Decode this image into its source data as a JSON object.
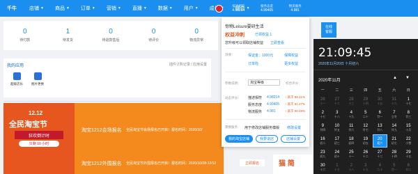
{
  "nav": {
    "logo": "千牛",
    "items": [
      "店铺",
      "商品",
      "订单",
      "营销",
      "直播",
      "数据",
      "用户",
      "成长",
      "综合"
    ]
  },
  "header_stats": [
    {
      "label": "描述相符",
      "value": "4.98214"
    },
    {
      "label": "服务态度",
      "value": "4.99405"
    },
    {
      "label": "物流服务",
      "value": "4.981"
    }
  ],
  "stats": [
    {
      "value": "0",
      "label": "待付款"
    },
    {
      "value": "1",
      "label": "待发货"
    },
    {
      "value": "0",
      "label": "待退款售后"
    },
    {
      "value": "0",
      "label": "待评价"
    },
    {
      "value": "0",
      "label": "物流异常"
    }
  ],
  "apps": {
    "title": "我的应用",
    "right": "插件订购记录 | 应用设置",
    "items": [
      {
        "label": "超级店长"
      },
      {
        "label": "图片更换"
      }
    ]
  },
  "banner": {
    "date": "12.12",
    "title": "全民淘宝节",
    "strip": "狂欢倒计时",
    "pill": "只剩 10 小时",
    "rows": [
      {
        "name": "淘宝1212会场报名",
        "desc": "全民淘宝节会场报名已开启！报名时间：2020/10/"
      },
      {
        "name": "淘宝1212外围报名",
        "desc": "全民淘宝节外围报名已开启！报名时间：2020/10/28-12/12"
      }
    ],
    "button": "立即报名"
  },
  "popup": {
    "shop_name": "惊物Leisure要研生活",
    "status": "权益冲刺",
    "status_link": "已领权益 1",
    "note": "您升级可以领取店铺权益",
    "note_link": "立即查看",
    "deposit_label": "消保：",
    "deposit_link": "保证金：1000元",
    "deposit_link2": "保障权益",
    "order_link": "订单险",
    "more_link": "更多权益",
    "level_label": "参数说明：",
    "level_value": "淘宝等级",
    "dsr_label": "综合评分：",
    "dsr_title": "动态评分：",
    "rows": [
      {
        "label": "描述相符",
        "value": "4.98214",
        "trend": "↑ 高于 89.21%"
      },
      {
        "label": "服务态度",
        "value": "4.99405",
        "trend": "↑ 高于 91.47%"
      },
      {
        "label": "物流服务",
        "value": "4.981",
        "trend": "↑ 高于 90.48%"
      }
    ],
    "service_label": "需换服务：",
    "service_text": "用于修改店铺服务模版",
    "service_link": "修改设置",
    "btn_primary": "我的淘宝店铺",
    "btn_secondary": "我要退店",
    "btn_tertiary": "店铺设置"
  },
  "help": {
    "line1": "在线",
    "line2": "客服"
  },
  "ad_bottom": "猫 简",
  "clock": {
    "time": "21:09:45",
    "date": "2020年11月20日 十月初六",
    "month": "2020年11月",
    "weekdays": [
      "一",
      "二",
      "三",
      "四",
      "五",
      "六",
      "日"
    ],
    "days": [
      {
        "d": "26",
        "lu": "十一",
        "dim": true
      },
      {
        "d": "27",
        "lu": "十二",
        "dim": true
      },
      {
        "d": "28",
        "lu": "十三",
        "dim": true
      },
      {
        "d": "29",
        "lu": "十四",
        "dim": true
      },
      {
        "d": "30",
        "lu": "十五",
        "dim": true
      },
      {
        "d": "31",
        "lu": "十六",
        "dim": true
      },
      {
        "d": "1",
        "lu": "十七"
      },
      {
        "d": "2",
        "lu": "十七"
      },
      {
        "d": "3",
        "lu": "十八"
      },
      {
        "d": "4",
        "lu": "十九"
      },
      {
        "d": "5",
        "lu": "二十"
      },
      {
        "d": "6",
        "lu": "廿一"
      },
      {
        "d": "7",
        "lu": "立冬"
      },
      {
        "d": "8",
        "lu": "廿三"
      },
      {
        "d": "9",
        "lu": "廿四"
      },
      {
        "d": "10",
        "lu": "廿五"
      },
      {
        "d": "11",
        "lu": "廿六"
      },
      {
        "d": "12",
        "lu": "廿七"
      },
      {
        "d": "13",
        "lu": "廿八"
      },
      {
        "d": "14",
        "lu": "廿九"
      },
      {
        "d": "15",
        "lu": "十月"
      },
      {
        "d": "16",
        "lu": "初二"
      },
      {
        "d": "17",
        "lu": "初三"
      },
      {
        "d": "18",
        "lu": "初四"
      },
      {
        "d": "19",
        "lu": "初五"
      },
      {
        "d": "20",
        "lu": "初六",
        "sel": true
      },
      {
        "d": "21",
        "lu": "初七"
      },
      {
        "d": "22",
        "lu": "小雪"
      },
      {
        "d": "23",
        "lu": "初九"
      },
      {
        "d": "24",
        "lu": "初十"
      },
      {
        "d": "25",
        "lu": "十一"
      },
      {
        "d": "26",
        "lu": "十二"
      },
      {
        "d": "27",
        "lu": "十三"
      },
      {
        "d": "28",
        "lu": "十四"
      },
      {
        "d": "29",
        "lu": "十五"
      },
      {
        "d": "30",
        "lu": "十六"
      },
      {
        "d": "1",
        "lu": "十七",
        "dim": true
      },
      {
        "d": "2",
        "lu": "十八",
        "dim": true
      },
      {
        "d": "3",
        "lu": "十九",
        "dim": true
      },
      {
        "d": "4",
        "lu": "二十",
        "dim": true
      },
      {
        "d": "5",
        "lu": "廿一",
        "dim": true
      },
      {
        "d": "6",
        "lu": "廿二",
        "dim": true
      }
    ]
  },
  "colors": {
    "brand": "#1a8ff0",
    "accent": "#e6561e"
  }
}
